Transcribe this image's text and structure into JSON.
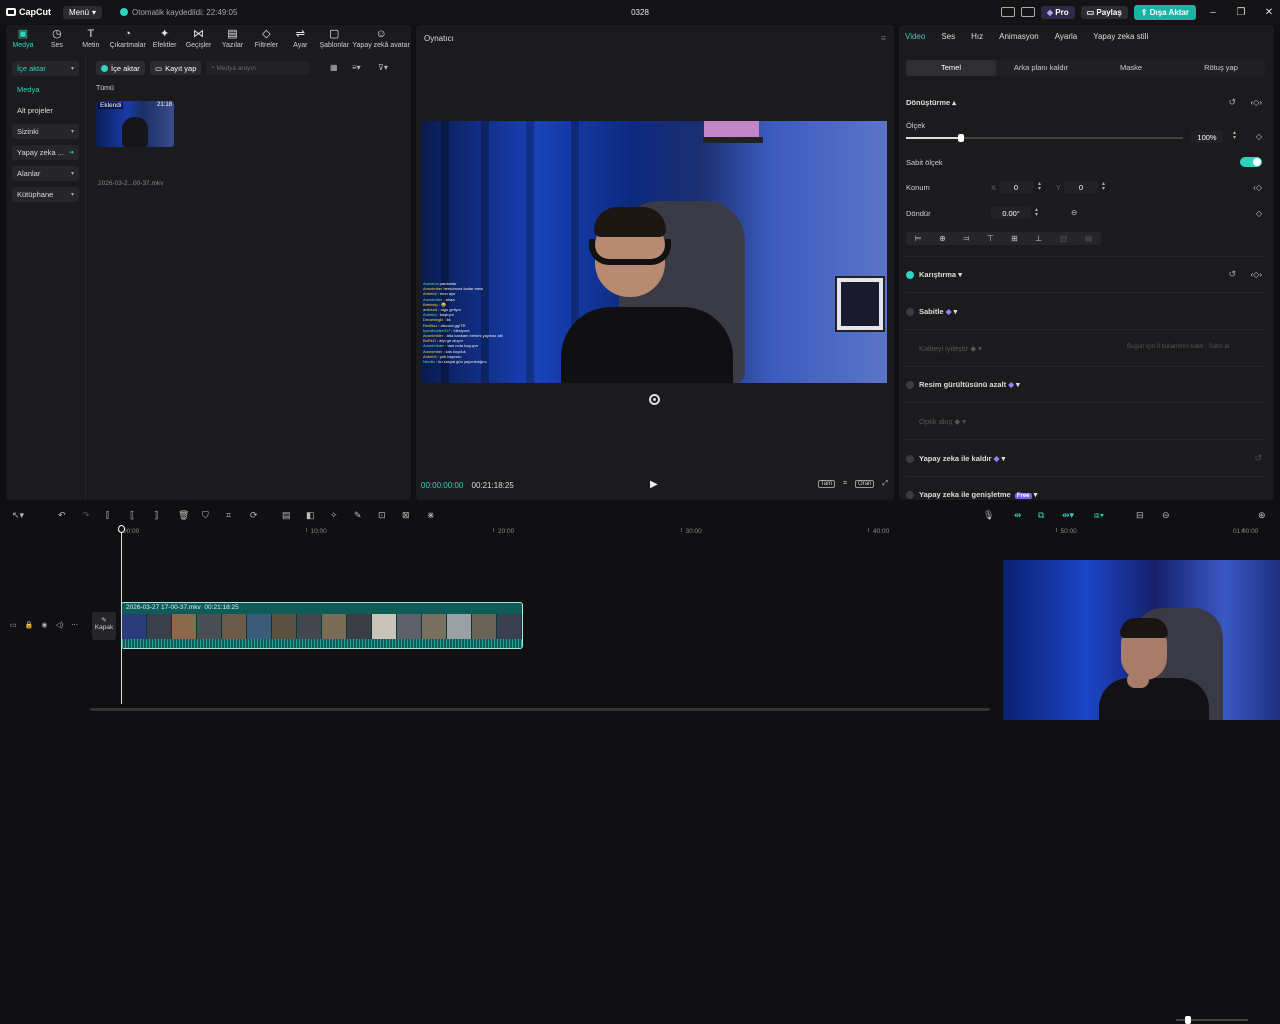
{
  "titlebar": {
    "app_name": "CapCut",
    "menu_label": "Menü",
    "autosave_text": "Otomatik kaydedildi: 22:49:05",
    "project_title": "0328",
    "pro_label": "Pro",
    "share_label": "Paylaş",
    "export_label": "Dışa Aktar",
    "minimize": "–",
    "maximize": "❐",
    "close": "✕"
  },
  "toolbar": {
    "items": [
      {
        "label": "Medya",
        "icon": "media-icon",
        "glyph": "▣"
      },
      {
        "label": "Ses",
        "icon": "audio-icon",
        "glyph": "◷"
      },
      {
        "label": "Metin",
        "icon": "text-icon",
        "glyph": "T"
      },
      {
        "label": "Çıkartmalar",
        "icon": "sticker-icon",
        "glyph": "◔"
      },
      {
        "label": "Efektler",
        "icon": "effects-icon",
        "glyph": "✦"
      },
      {
        "label": "Geçişler",
        "icon": "transitions-icon",
        "glyph": "⋈"
      },
      {
        "label": "Yazılar",
        "icon": "captions-icon",
        "glyph": "▤"
      },
      {
        "label": "Filtreler",
        "icon": "filters-icon",
        "glyph": "◇"
      },
      {
        "label": "Ayar",
        "icon": "adjust-icon",
        "glyph": "⇌"
      },
      {
        "label": "Şablonlar",
        "icon": "templates-icon",
        "glyph": "▢"
      },
      {
        "label": "Yapay zekâ avatar",
        "icon": "ai-avatar-icon",
        "glyph": "☺"
      }
    ]
  },
  "sidebar": {
    "items": [
      {
        "label": "İçe aktar",
        "chevron": "▾"
      },
      {
        "label": "Medya",
        "chevron": ""
      },
      {
        "label": "Alt projeler",
        "chevron": ""
      },
      {
        "label": "Sizinki",
        "chevron": "▾"
      },
      {
        "label": "Yapay zeka ...",
        "chevron": "➜"
      },
      {
        "label": "Alanlar",
        "chevron": "▾"
      },
      {
        "label": "Kütüphane",
        "chevron": "▾"
      }
    ]
  },
  "media": {
    "import_label": "İçe aktar",
    "record_label": "Kayıt yap",
    "search_placeholder": "Medya arayın",
    "filter_label": "Tümü",
    "thumb_badge": "Eklendi",
    "thumb_duration": "21:18",
    "thumb_name": "2026-03-2...00-37.mkv"
  },
  "player": {
    "title": "Oynatıcı",
    "current_time": "00:00:00:00",
    "total_time": "00:21:18:25",
    "full_label": "Tam",
    "ratio_label": "Oran",
    "chat_lines": [
      {
        "u": "Anonimx",
        "t": " pardonlar"
      },
      {
        "u": "Anonimber",
        "t": " hersonuna kadar mew"
      },
      {
        "u": "Anbelot",
        "t": " : mun ayo"
      },
      {
        "u": "Anonimber",
        "t": " : ahaa"
      },
      {
        "u": "Brtekelp",
        "t": " : 😂"
      },
      {
        "u": "anildurd",
        "t": " : olgu geliyor"
      },
      {
        "u": "Anbelot",
        "t": " : başlıyor"
      },
      {
        "u": "Dreamingki",
        "t": " : kk"
      },
      {
        "u": "RedBuz",
        "t": " : discord.gg/TR"
      },
      {
        "u": "byexitcoder007",
        "t": " : bilmiyord"
      },
      {
        "u": "Anonimbier",
        "t": " : aha kankam herkes yaymaz abi"
      },
      {
        "u": "BoRkO",
        "t": " : afyl ge oluyor"
      },
      {
        "u": "Anoniminan",
        "t": " : tam nota koyuyor"
      },
      {
        "u": "Anonimber",
        "t": " : kas koyduk"
      },
      {
        "u": "Anbelot",
        "t": " : yok başvuru"
      },
      {
        "u": "Nerdlo",
        "t": " : bu sosyal gün yayımlıdığını"
      }
    ]
  },
  "inspector": {
    "tabs": [
      "Video",
      "Ses",
      "Hız",
      "Animasyon",
      "Ayarla",
      "Yapay zeka stili"
    ],
    "subtabs": [
      "Temel",
      "Arka planı kaldır",
      "Maske",
      "Rötuş yap"
    ],
    "transform_title": "Dönüştürme",
    "scale_label": "Ölçek",
    "scale_value": "100%",
    "scale_level": 1.0,
    "uniform_scale_label": "Sabit ölçek",
    "position_label": "Konum",
    "x_label": "X",
    "x_value": "0",
    "y_label": "Y",
    "y_value": "0",
    "rotate_label": "Döndür",
    "rotate_value": "0.00°",
    "blend_label": "Karıştırma",
    "stabilize_label": "Sabitle",
    "enhance_label": "Kaliteyi iyileştir",
    "enhance_hint": "Bugün için 3 kullanımın kaldı · Satın al",
    "denoise_label": "Resim gürültüsünü azalt",
    "optical_flow_label": "Optik akış",
    "ai_remove_label": "Yapay zeka ile kaldır",
    "ai_expand_label": "Yapay zeka ile genişletme",
    "free_badge": "Free",
    "accent": "#2dd4bf"
  },
  "timeline": {
    "ruler": [
      "00:00",
      "10:00",
      "20:00",
      "30:00",
      "40:00",
      "50:00",
      "01:00:00"
    ],
    "cover_label": "Kapak",
    "clip_name": "2026-03-27 17-00-37.mkv",
    "clip_duration": "00:21:18:25"
  }
}
